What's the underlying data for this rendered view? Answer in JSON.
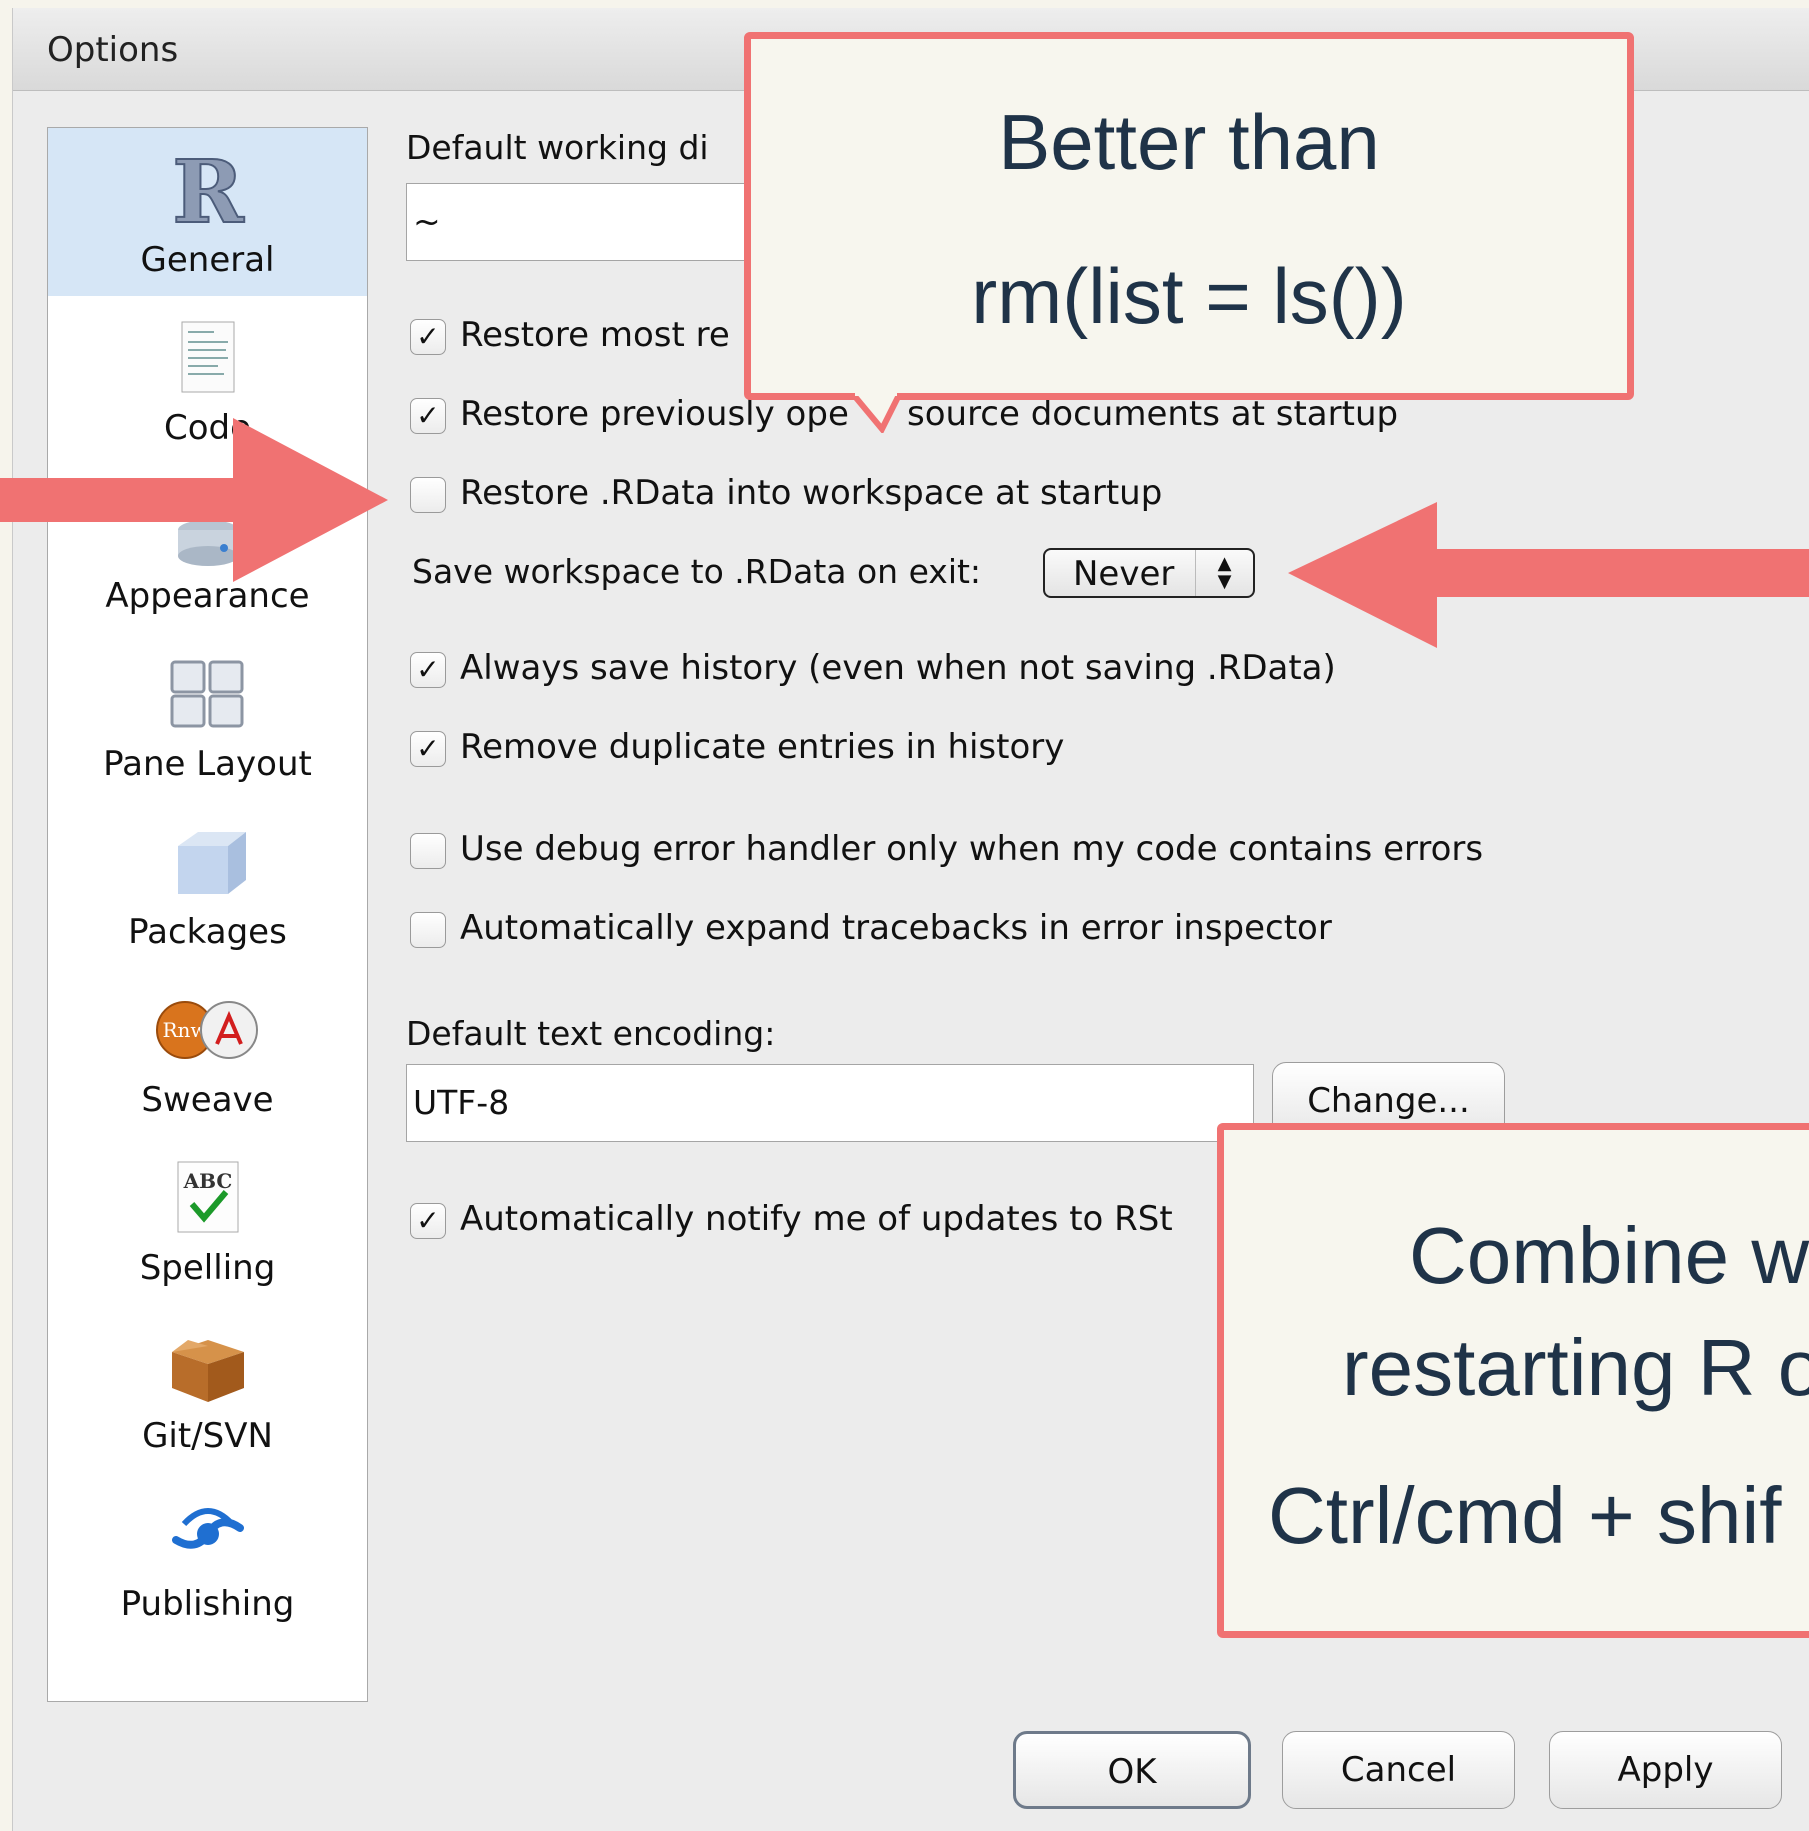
{
  "window": {
    "title": "Options"
  },
  "sidebar": {
    "items": [
      {
        "label": "General",
        "icon": "r-logo-icon",
        "selected": true
      },
      {
        "label": "Code",
        "icon": "code-document-icon"
      },
      {
        "label": "Appearance",
        "icon": "appearance-icon"
      },
      {
        "label": "Pane Layout",
        "icon": "pane-layout-icon"
      },
      {
        "label": "Packages",
        "icon": "package-box-icon"
      },
      {
        "label": "Sweave",
        "icon": "sweave-pdf-icon"
      },
      {
        "label": "Spelling",
        "icon": "spelling-abc-icon"
      },
      {
        "label": "Git/SVN",
        "icon": "cardboard-box-icon"
      },
      {
        "label": "Publishing",
        "icon": "publishing-icon"
      }
    ]
  },
  "general": {
    "working_dir_label": "Default working di",
    "working_dir_value": "~",
    "checkboxes": [
      {
        "label": "Restore most re",
        "checked": true
      },
      {
        "label": "Restore previously ope",
        "label_after": "source documents at startup",
        "checked": true
      },
      {
        "label": "Restore .RData into workspace at startup",
        "checked": false
      },
      {
        "label": "Always save history (even when not saving .RData)",
        "checked": true
      },
      {
        "label": "Remove duplicate entries in history",
        "checked": true
      },
      {
        "label": "Use debug error handler only when my code contains errors",
        "checked": false
      },
      {
        "label": "Automatically expand tracebacks in error inspector",
        "checked": false
      },
      {
        "label": "Automatically notify me of updates to RSt",
        "checked": true
      }
    ],
    "save_workspace_label": "Save workspace to .RData on exit:",
    "save_workspace_value": "Never",
    "encoding_label": "Default text encoding:",
    "encoding_value": "UTF-8",
    "change_button": "Change..."
  },
  "buttons": {
    "ok": "OK",
    "cancel": "Cancel",
    "apply": "Apply"
  },
  "callouts": {
    "top": [
      "Better than",
      "rm(list = ls())"
    ],
    "bottom": [
      "Combine w",
      "restarting R o",
      "Ctrl/cmd + shif"
    ]
  },
  "colors": {
    "annotation": "#f07272",
    "selection": "#d6e6f6"
  }
}
